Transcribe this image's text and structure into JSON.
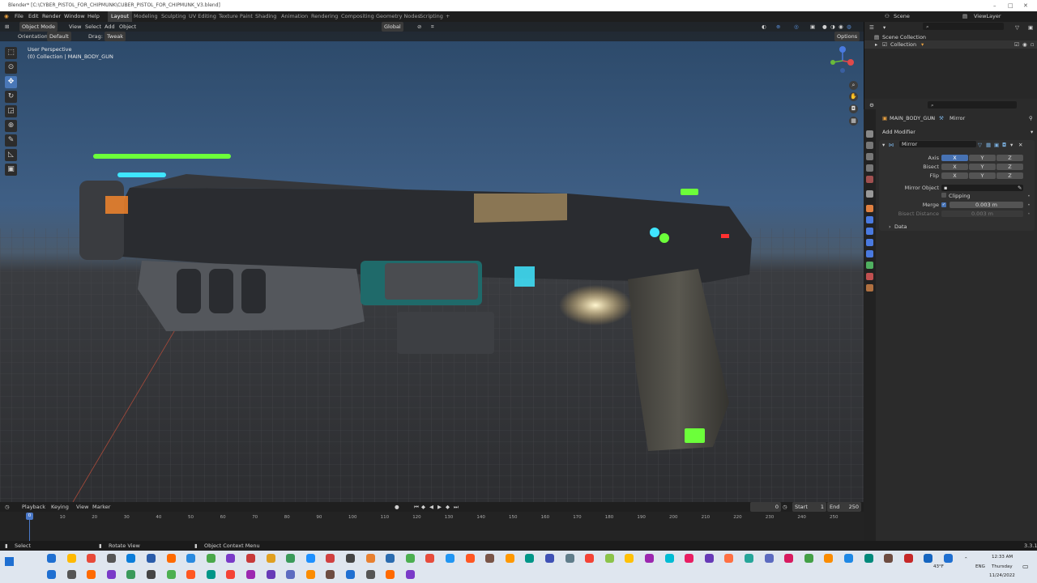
{
  "window": {
    "title": "Blender* [C:\\CYBER_PISTOL_FOR_CHIPMUNK\\CUBER_PISTOL_FOR_CHIPMUNK_V3.blend]"
  },
  "menu": [
    "File",
    "Edit",
    "Render",
    "Window",
    "Help"
  ],
  "workspaces": [
    "Layout",
    "Modeling",
    "Sculpting",
    "UV Editing",
    "Texture Paint",
    "Shading",
    "Animation",
    "Rendering",
    "Compositing",
    "Geometry Nodes",
    "Scripting",
    "+"
  ],
  "top_right": {
    "scene": "Scene",
    "view_layer": "ViewLayer"
  },
  "viewport_header": {
    "mode": "Object Mode",
    "view": "View",
    "select": "Select",
    "add": "Add",
    "object": "Object",
    "transform": "Global"
  },
  "tool_settings": {
    "orientation_label": "Orientation:",
    "orientation": "Default",
    "drag_label": "Drag:",
    "drag": "Tweak",
    "options": "Options"
  },
  "viewport_overlay": {
    "perspective": "User Perspective",
    "collection": "(0) Collection | MAIN_BODY_GUN"
  },
  "outliner": {
    "scene_collection": "Scene Collection",
    "collection": "Collection"
  },
  "properties": {
    "object": "MAIN_BODY_GUN",
    "modifier_crumb": "Mirror",
    "add_modifier": "Add Modifier",
    "modifier_name": "Mirror",
    "axis_label": "Axis",
    "bisect_label": "Bisect",
    "flip_label": "Flip",
    "x": "X",
    "y": "Y",
    "z": "Z",
    "mirror_object_label": "Mirror Object",
    "clipping": "Clipping",
    "merge_label": "Merge",
    "merge_value": "0.003 m",
    "bisect_distance_label": "Bisect Distance",
    "bisect_distance_value": "0.003 m",
    "data": "Data"
  },
  "timeline": {
    "playback": "Playback",
    "keying": "Keying",
    "view": "View",
    "marker": "Marker",
    "current_frame": "0",
    "start_label": "Start",
    "start": "1",
    "end_label": "End",
    "end": "250",
    "ticks": [
      "0",
      "10",
      "20",
      "30",
      "40",
      "50",
      "60",
      "70",
      "80",
      "90",
      "100",
      "110",
      "120",
      "130",
      "140",
      "150",
      "160",
      "170",
      "180",
      "190",
      "200",
      "210",
      "220",
      "230",
      "240",
      "250"
    ]
  },
  "status": {
    "select": "Select",
    "rotate": "Rotate View",
    "context": "Object Context Menu",
    "version": "3.3.1"
  },
  "taskbar": {
    "weather": "43°F",
    "lang": "ENG",
    "time": "12:33 AM",
    "day": "Thursday",
    "date": "11/24/2022"
  },
  "colors": {
    "accent": "#4772b3",
    "header": "#1e1e1e",
    "panel": "#2b2b2b",
    "glow_green": "#6cff3a",
    "glow_cyan": "#3fe6ff",
    "glow_orange": "#ff8a2a"
  }
}
